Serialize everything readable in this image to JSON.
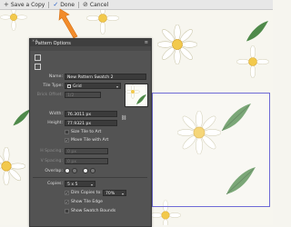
{
  "topbar": {
    "save_copy": "Save a Copy",
    "done": "Done",
    "cancel": "Cancel",
    "icons": [
      "plus-icon",
      "check-icon",
      "cancel-icon"
    ]
  },
  "accent_color": "#f28c2b",
  "panel": {
    "title": "Pattern Options",
    "fields": {
      "name_label": "Name:",
      "name_value": "New Pattern Swatch 2",
      "tile_type_label": "Tile Type:",
      "tile_type_value": "Grid",
      "brick_offset_label": "Brick Offset:",
      "brick_offset_value": "1/2",
      "width_label": "Width:",
      "width_value": "76.3011 px",
      "height_label": "Height:",
      "height_value": "77.9321 px",
      "h_spacing_label": "H Spacing:",
      "h_spacing_value": "0 px",
      "v_spacing_label": "V Spacing:",
      "v_spacing_value": "0 px",
      "overlap_label": "Overlap:",
      "copies_label": "Copies:",
      "copies_value": "5 x 5"
    },
    "checkboxes": {
      "size_tile": {
        "label": "Size Tile to Art",
        "checked": false
      },
      "move_tile": {
        "label": "Move Tile with Art",
        "checked": true
      },
      "dim_copies": {
        "label": "Dim Copies to:",
        "checked": true,
        "value": "70%"
      },
      "show_tile_edge": {
        "label": "Show Tile Edge",
        "checked": true
      },
      "show_swatch_bounds": {
        "label": "Show Swatch Bounds",
        "checked": false
      }
    }
  },
  "tile_border_color": "#6e6ad6"
}
